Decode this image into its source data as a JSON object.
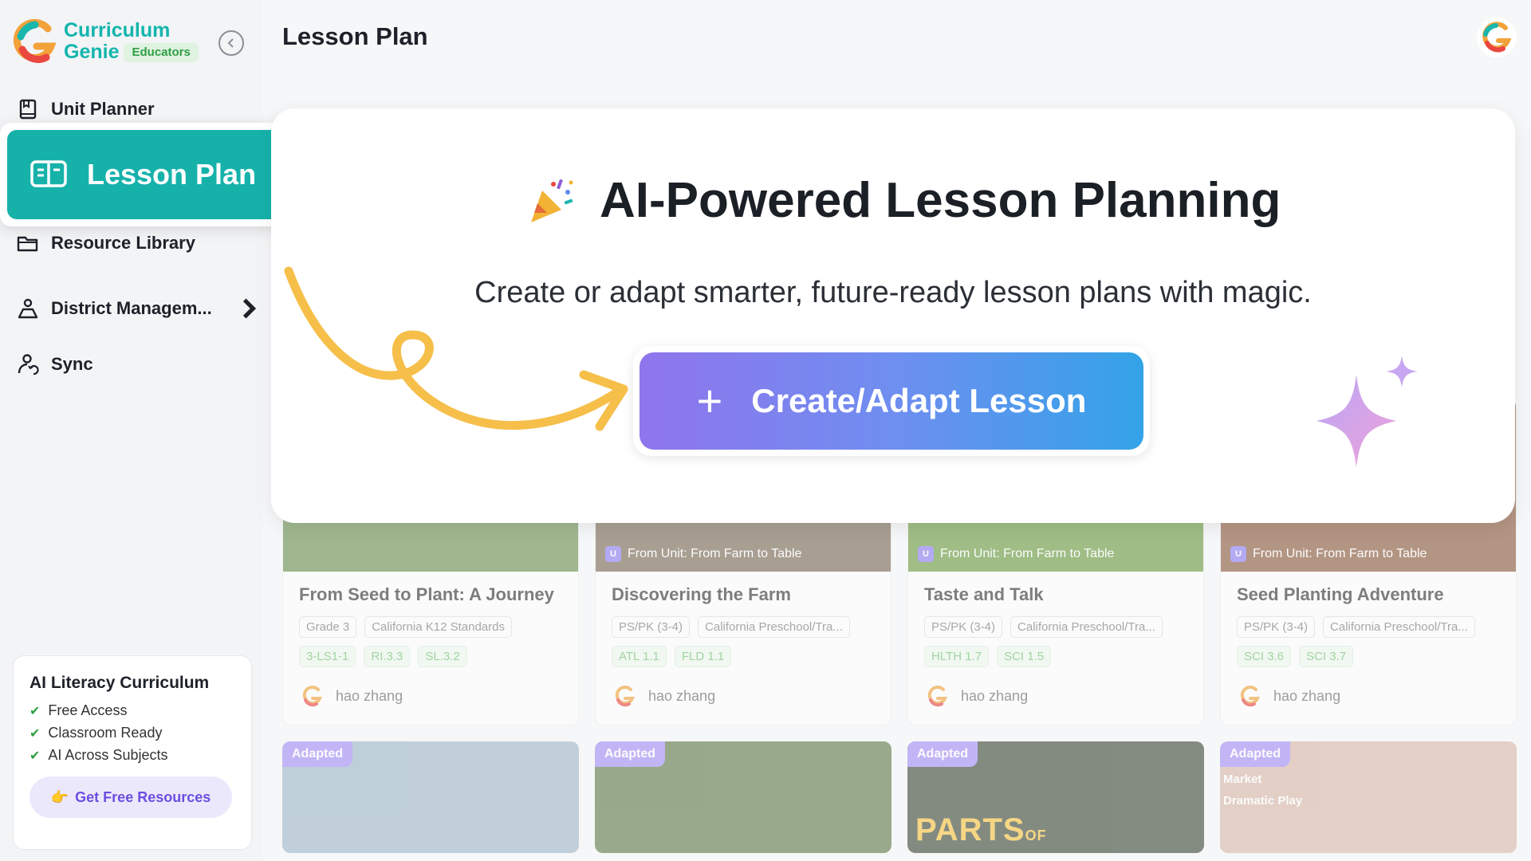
{
  "brand": {
    "name_line1": "Curriculum",
    "name_line2": "Genie",
    "badge": "Educators"
  },
  "nav": {
    "items": [
      {
        "label": "Unit Planner",
        "icon": "book-icon"
      },
      {
        "label": "Lesson Plan",
        "icon": "open-book-icon"
      },
      {
        "label": "Resource Library",
        "icon": "folder-icon"
      },
      {
        "label": "District Managem...",
        "icon": "user-tree-icon"
      },
      {
        "label": "Sync",
        "icon": "sync-users-icon"
      }
    ]
  },
  "page": {
    "title": "Lesson Plan"
  },
  "popup": {
    "title": "AI-Powered Lesson Planning",
    "subtitle": "Create or adapt smarter, future-ready lesson plans with magic.",
    "cta_label": "Create/Adapt Lesson"
  },
  "promo": {
    "title": "AI Literacy Curriculum",
    "features": [
      "Free Access",
      "Classroom Ready",
      "AI Across Subjects"
    ],
    "button_label": "Get Free Resources"
  },
  "cards": [
    {
      "tag": "",
      "title": "From Seed to Plant: A Journey",
      "grade": "Grade 3",
      "standard_set": "California K12 Standards",
      "standards": [
        "3-LS1-1",
        "RI.3.3",
        "SL.3.2"
      ],
      "author": "hao zhang",
      "image_color": "#6b8f4e"
    },
    {
      "tag": "From Unit: From Farm to Table",
      "title": "Discovering the Farm",
      "grade": "PS/PK (3-4)",
      "standard_set": "California Preschool/Tra...",
      "standards": [
        "ATL 1.1",
        "FLD 1.1"
      ],
      "author": "hao zhang",
      "image_color": "#7a6a55"
    },
    {
      "tag": "From Unit: From Farm to Table",
      "title": "Taste and Talk",
      "grade": "PS/PK (3-4)",
      "standard_set": "California Preschool/Tra...",
      "standards": [
        "HLTH 1.7",
        "SCI 1.5"
      ],
      "author": "hao zhang",
      "image_color": "#6a9b3f"
    },
    {
      "tag": "From Unit: From Farm to Table",
      "title": "Seed Planting Adventure",
      "grade": "PS/PK (3-4)",
      "standard_set": "California Preschool/Tra...",
      "standards": [
        "SCI 3.6",
        "SCI 3.7"
      ],
      "author": "hao zhang",
      "image_color": "#8b5a3c"
    }
  ],
  "adapted_cards": [
    {
      "badge": "Adapted",
      "image_color": "#9fb7c9",
      "overlay": "",
      "overlay_sub": ""
    },
    {
      "badge": "Adapted",
      "image_color": "#5f7a4a",
      "overlay": "",
      "overlay_sub": ""
    },
    {
      "badge": "Adapted",
      "image_color": "#3d4a3a",
      "overlay": "PARTS",
      "overlay_sub": "OF"
    },
    {
      "badge": "Adapted",
      "image_color": "#d9b8a8",
      "overlay": "",
      "overlay_sub": "Market\nDramatic Play"
    }
  ],
  "colors": {
    "accent": "#16b2aa",
    "cta_start": "#8f75ec",
    "cta_end": "#33a3e8",
    "arrow": "#f6bf4a"
  }
}
